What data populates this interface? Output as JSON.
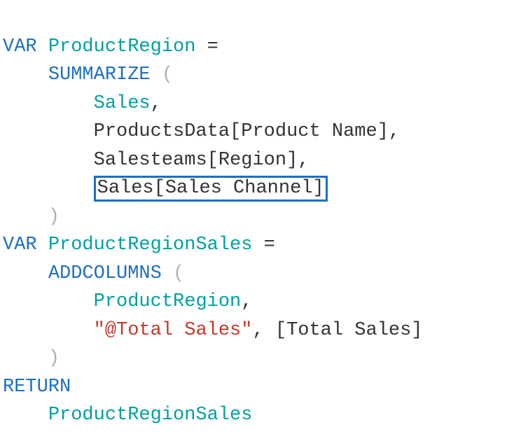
{
  "kw": {
    "var": "VAR",
    "return": "RETURN",
    "summarize": "SUMMARIZE",
    "addcolumns": "ADDCOLUMNS"
  },
  "vars": {
    "productRegion": "ProductRegion",
    "productRegionSales": "ProductRegionSales"
  },
  "refs": {
    "sales": "Sales",
    "productsData_productName": "ProductsData[Product Name]",
    "salesteams_region": "Salesteams[Region]",
    "sales_salesChannel": "Sales[Sales Channel]",
    "totalSales": "[Total Sales]"
  },
  "strings": {
    "atTotalSales": "\"@Total Sales\""
  },
  "punct": {
    "eq": " =",
    "open": "(",
    "close": ")",
    "comma": ","
  }
}
